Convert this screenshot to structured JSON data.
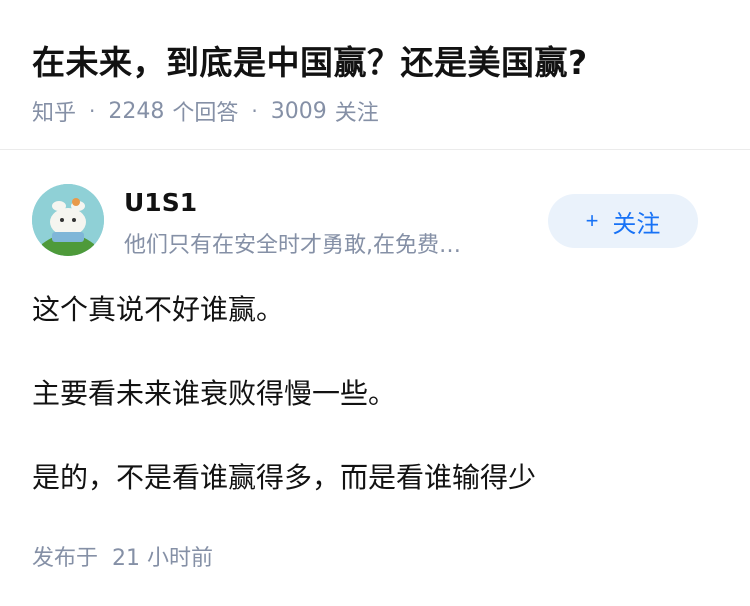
{
  "question": {
    "title": "在未来，到底是中国赢？还是美国赢?",
    "source": "知乎",
    "separator": "·",
    "answer_count": "2248",
    "answer_label": "个回答",
    "follower_count": "3009",
    "follower_label": "关注"
  },
  "author": {
    "name": "U1S1",
    "bio": "他们只有在安全时才勇敢,在免费…",
    "follow_label": "关注",
    "follow_icon": "plus-icon"
  },
  "answer": {
    "paragraphs": [
      "这个真说不好谁赢。",
      "主要看未来谁衰败得慢一些。",
      "是的，不是看谁赢得多，而是看谁输得少"
    ],
    "published": "发布于  21 小时前"
  },
  "colors": {
    "accent": "#1772f6",
    "follow_bg": "#eaf2fb",
    "meta_gray": "#8590a6",
    "text": "#121212"
  }
}
